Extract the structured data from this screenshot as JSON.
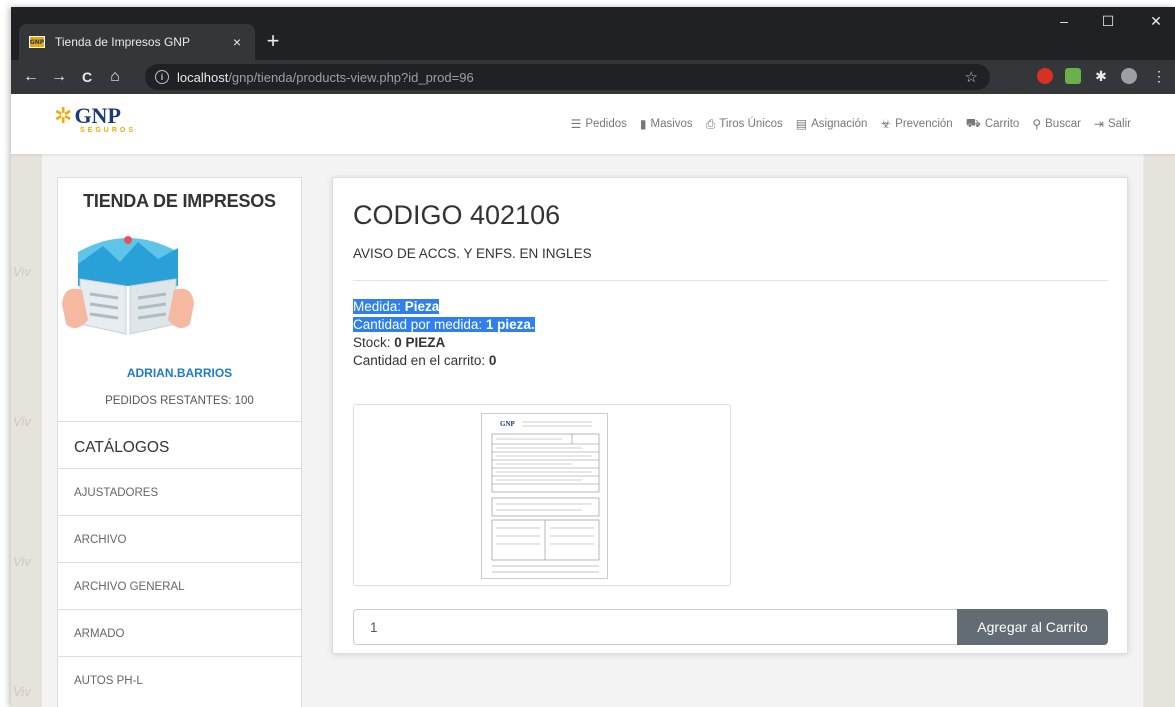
{
  "browser": {
    "tab_title": "Tienda de Impresos GNP",
    "tab_favicon_text": "GNP",
    "new_tab_symbol": "+",
    "close_tab_symbol": "×",
    "url_host": "localhost",
    "url_path": "/gnp/tienda/products-view.php?id_prod=96",
    "window_controls": {
      "minimize": "–",
      "maximize": "☐",
      "close": "✕"
    },
    "nav": {
      "back": "←",
      "forward": "→",
      "reload": "C",
      "home": "⌂"
    }
  },
  "brand": {
    "logo_text": "GNP",
    "logo_sub": "SEGUROS",
    "primary_color": "#1a3a7a",
    "accent_color": "#f2a900"
  },
  "menu": [
    {
      "icon": "list-icon",
      "glyph": "☰",
      "label": "Pedidos"
    },
    {
      "icon": "cards-icon",
      "glyph": "▮",
      "label": "Masivos"
    },
    {
      "icon": "print-icon",
      "glyph": "⎙",
      "label": "Tiros Únicos"
    },
    {
      "icon": "clipboard-icon",
      "glyph": "▤",
      "label": "Asignación"
    },
    {
      "icon": "biohazard-icon",
      "glyph": "☣",
      "label": "Prevención"
    },
    {
      "icon": "cart-icon",
      "glyph": "⛟",
      "label": "Carrito"
    },
    {
      "icon": "search-icon",
      "glyph": "⚲",
      "label": "Buscar"
    },
    {
      "icon": "logout-icon",
      "glyph": "⇥",
      "label": "Salir"
    }
  ],
  "sidebar": {
    "title": "TIENDA DE IMPRESOS",
    "username": "ADRIAN.BARRIOS",
    "remaining": "PEDIDOS RESTANTES: 100",
    "catalog_header": "CATÁLOGOS",
    "catalogs": [
      "AJUSTADORES",
      "ARCHIVO",
      "ARCHIVO GENERAL",
      "ARMADO",
      "AUTOS PH-L"
    ]
  },
  "product": {
    "code": "CODIGO 402106",
    "description": "AVISO DE ACCS. Y ENFS. EN INGLES",
    "medida_label": "Medida: ",
    "medida_value": "Pieza",
    "cantidad_medida_label": "Cantidad por medida: ",
    "cantidad_medida_value": "1 pieza.",
    "stock_label": "Stock: ",
    "stock_value": "0 PIEZA",
    "carrito_label": "Cantidad en el carrito: ",
    "carrito_value": "0",
    "doc_logo": "GNP"
  },
  "form": {
    "quantity_value": "1",
    "add_button": "Agregar al Carrito"
  },
  "watermark_text": "Viv"
}
